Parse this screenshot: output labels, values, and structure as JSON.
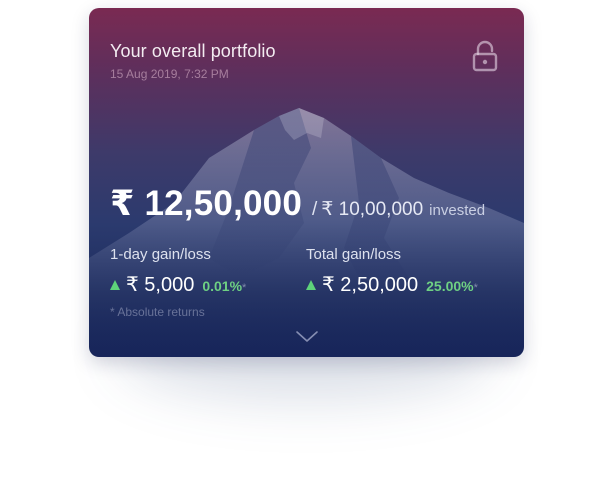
{
  "card": {
    "title": "Your overall portfolio",
    "timestamp": "15 Aug 2019, 7:32 PM",
    "lock_icon": "unlocked-padlock-icon",
    "current_value": "₹ 12,50,000",
    "invested_separator": "/",
    "invested_value": "₹ 10,00,000",
    "invested_label": "invested",
    "day_gain": {
      "label": "1-day gain/loss",
      "amount": "₹ 5,000",
      "percent": "0.01%",
      "marker": "*",
      "direction": "up"
    },
    "total_gain": {
      "label": "Total gain/loss",
      "amount": "₹ 2,50,000",
      "percent": "25.00%",
      "marker": "*",
      "direction": "up"
    },
    "footnote": "* Absolute returns",
    "expand_icon": "chevron-down-icon"
  },
  "colors": {
    "gradient_top": "#7a2a52",
    "gradient_bottom": "#17255a",
    "gain_green": "#6ed083"
  }
}
